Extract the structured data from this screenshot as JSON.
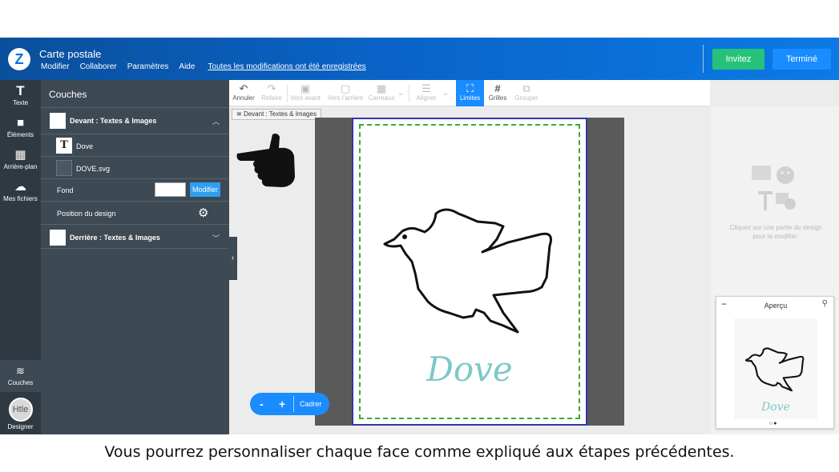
{
  "header": {
    "logo": "Z",
    "title": "Carte postale",
    "menu": [
      "Modifier",
      "Collaborer",
      "Paramètres",
      "Aide"
    ],
    "saved_status": "Toutes les modifications ont été enregistrées",
    "invite_label": "Invitez",
    "done_label": "Terminé"
  },
  "iconbar": {
    "items": [
      {
        "label": "Texte",
        "icon": "T"
      },
      {
        "label": "Éléments",
        "icon": "■"
      },
      {
        "label": "Arrière-plan",
        "icon": "▦"
      },
      {
        "label": "Mes fichiers",
        "icon": "☁"
      }
    ],
    "layers_label": "Couches",
    "designer_label": "Designer",
    "designer_avatar_text": "Htle"
  },
  "layers": {
    "title": "Couches",
    "front_group": "Devant : Textes & Images",
    "items": [
      {
        "label": "Dove",
        "icon": "T"
      },
      {
        "label": "DOVE.svg",
        "icon": "svg-thumb"
      }
    ],
    "background_label": "Fond",
    "background_color": "#ffffff",
    "modify_label": "Modifier",
    "design_position_label": "Position du design",
    "back_group": "Derrière : Textes & Images"
  },
  "toolbar": {
    "items": [
      {
        "label": "Annuler",
        "icon": "↶",
        "enabled": true
      },
      {
        "label": "Refaire",
        "icon": "↷",
        "enabled": false
      },
      {
        "label": "Vers avant",
        "icon": "▣",
        "enabled": false
      },
      {
        "label": "Vers l'arrière",
        "icon": "▢",
        "enabled": false
      },
      {
        "label": "Carreaux",
        "icon": "▦",
        "enabled": false
      },
      {
        "label": "Aligner",
        "icon": "☰",
        "enabled": false
      },
      {
        "label": "Limites",
        "icon": "⛶",
        "enabled": true,
        "active": true
      },
      {
        "label": "Grilles",
        "icon": "#",
        "enabled": true
      },
      {
        "label": "Grouper",
        "icon": "⧉",
        "enabled": false
      }
    ]
  },
  "face_label": "Devant : Textes & Images",
  "card": {
    "text": "Dove",
    "text_color": "#7cc9c6"
  },
  "zoom": {
    "minus": "-",
    "plus": "+",
    "fit_label": "Cadrer"
  },
  "right_panel": {
    "hint": "Cliquez sur une partie du design pour la modifier.",
    "preview_title": "Aperçu",
    "preview_text": "Dove"
  },
  "caption": "Vous pourrez personnaliser chaque face comme expliqué aux étapes précédentes."
}
